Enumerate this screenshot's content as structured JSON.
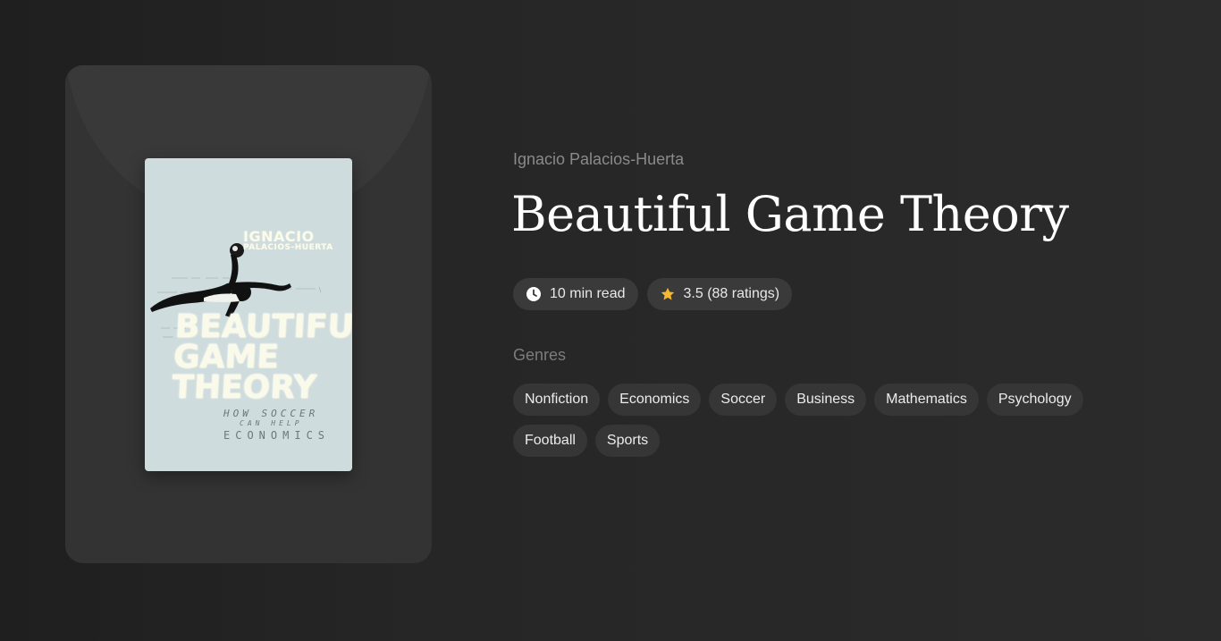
{
  "book": {
    "author": "Ignacio Palacios-Huerta",
    "title": "Beautiful Game Theory",
    "cover": {
      "author_first": "IGNACIO",
      "author_last": "PALACIOS-HUERTA",
      "title_lines": [
        "BEAUTIFUL",
        "GAME",
        "THEORY"
      ],
      "subtitle_lines": [
        "HOW SOCCER",
        "CAN HELP",
        "ECONOMICS"
      ]
    }
  },
  "meta": {
    "read_time": "10 min read",
    "rating": "3.5 (88 ratings)",
    "read_time_icon": "clock-icon",
    "rating_icon": "star-icon"
  },
  "genres": {
    "label": "Genres",
    "items": [
      "Nonfiction",
      "Economics",
      "Soccer",
      "Business",
      "Mathematics",
      "Psychology",
      "Football",
      "Sports"
    ]
  },
  "colors": {
    "star": "#f5b82e",
    "cover_background": "#cfdcdd"
  }
}
